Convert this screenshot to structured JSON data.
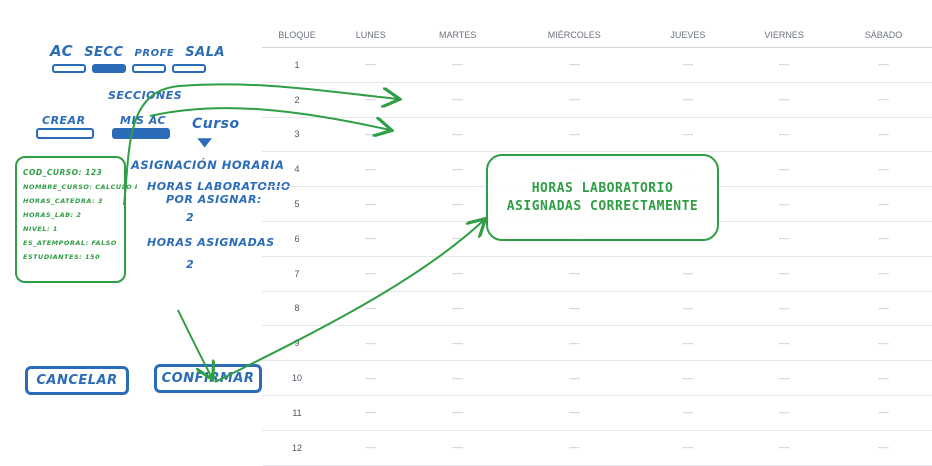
{
  "tabs": [
    "AC",
    "SECC",
    "PROFE",
    "SALA"
  ],
  "section_title": "SECCIONES",
  "crear_label": "CREAR",
  "misac_label": "MIS AC",
  "curso_label": "Curso",
  "course_card": {
    "cod": "COD_CURSO: 123",
    "nombre": "NOMBRE_CURSO: CALCULO I",
    "horas_catedra": "HORAS_CATEDRA: 3",
    "horas_lab": "HORAS_LAB: 2",
    "nivel": "NIVEL: 1",
    "es_atemporal": "ES_ATEMPORAL: FALSO",
    "estudiantes": "ESTUDIANTES: 150"
  },
  "assignment": {
    "title": "ASIGNACIÓN HORARIA",
    "lab_label_1": "HORAS LABORATORIO",
    "lab_label_2": "POR ASIGNAR:",
    "lab_value": "2",
    "assigned_label": "HORAS ASIGNADAS",
    "assigned_value": "2"
  },
  "cancel_label": "CANCELAR",
  "confirm_label": "CONFIRMAR",
  "table": {
    "headers": [
      "BLOQUE",
      "LUNES",
      "MARTES",
      "MIÉRCOLES",
      "JUEVES",
      "VIERNES",
      "SÁBADO"
    ],
    "rows": [
      "1",
      "2",
      "3",
      "4",
      "5",
      "6",
      "7",
      "8",
      "9",
      "10",
      "11",
      "12"
    ],
    "empty": "----"
  },
  "toast": {
    "line1": "HORAS LABORATORIO",
    "line2": "ASIGNADAS CORRECTAMENTE"
  },
  "colors": {
    "sketch_blue": "#2b6cb8",
    "sketch_green": "#2f9e44"
  }
}
